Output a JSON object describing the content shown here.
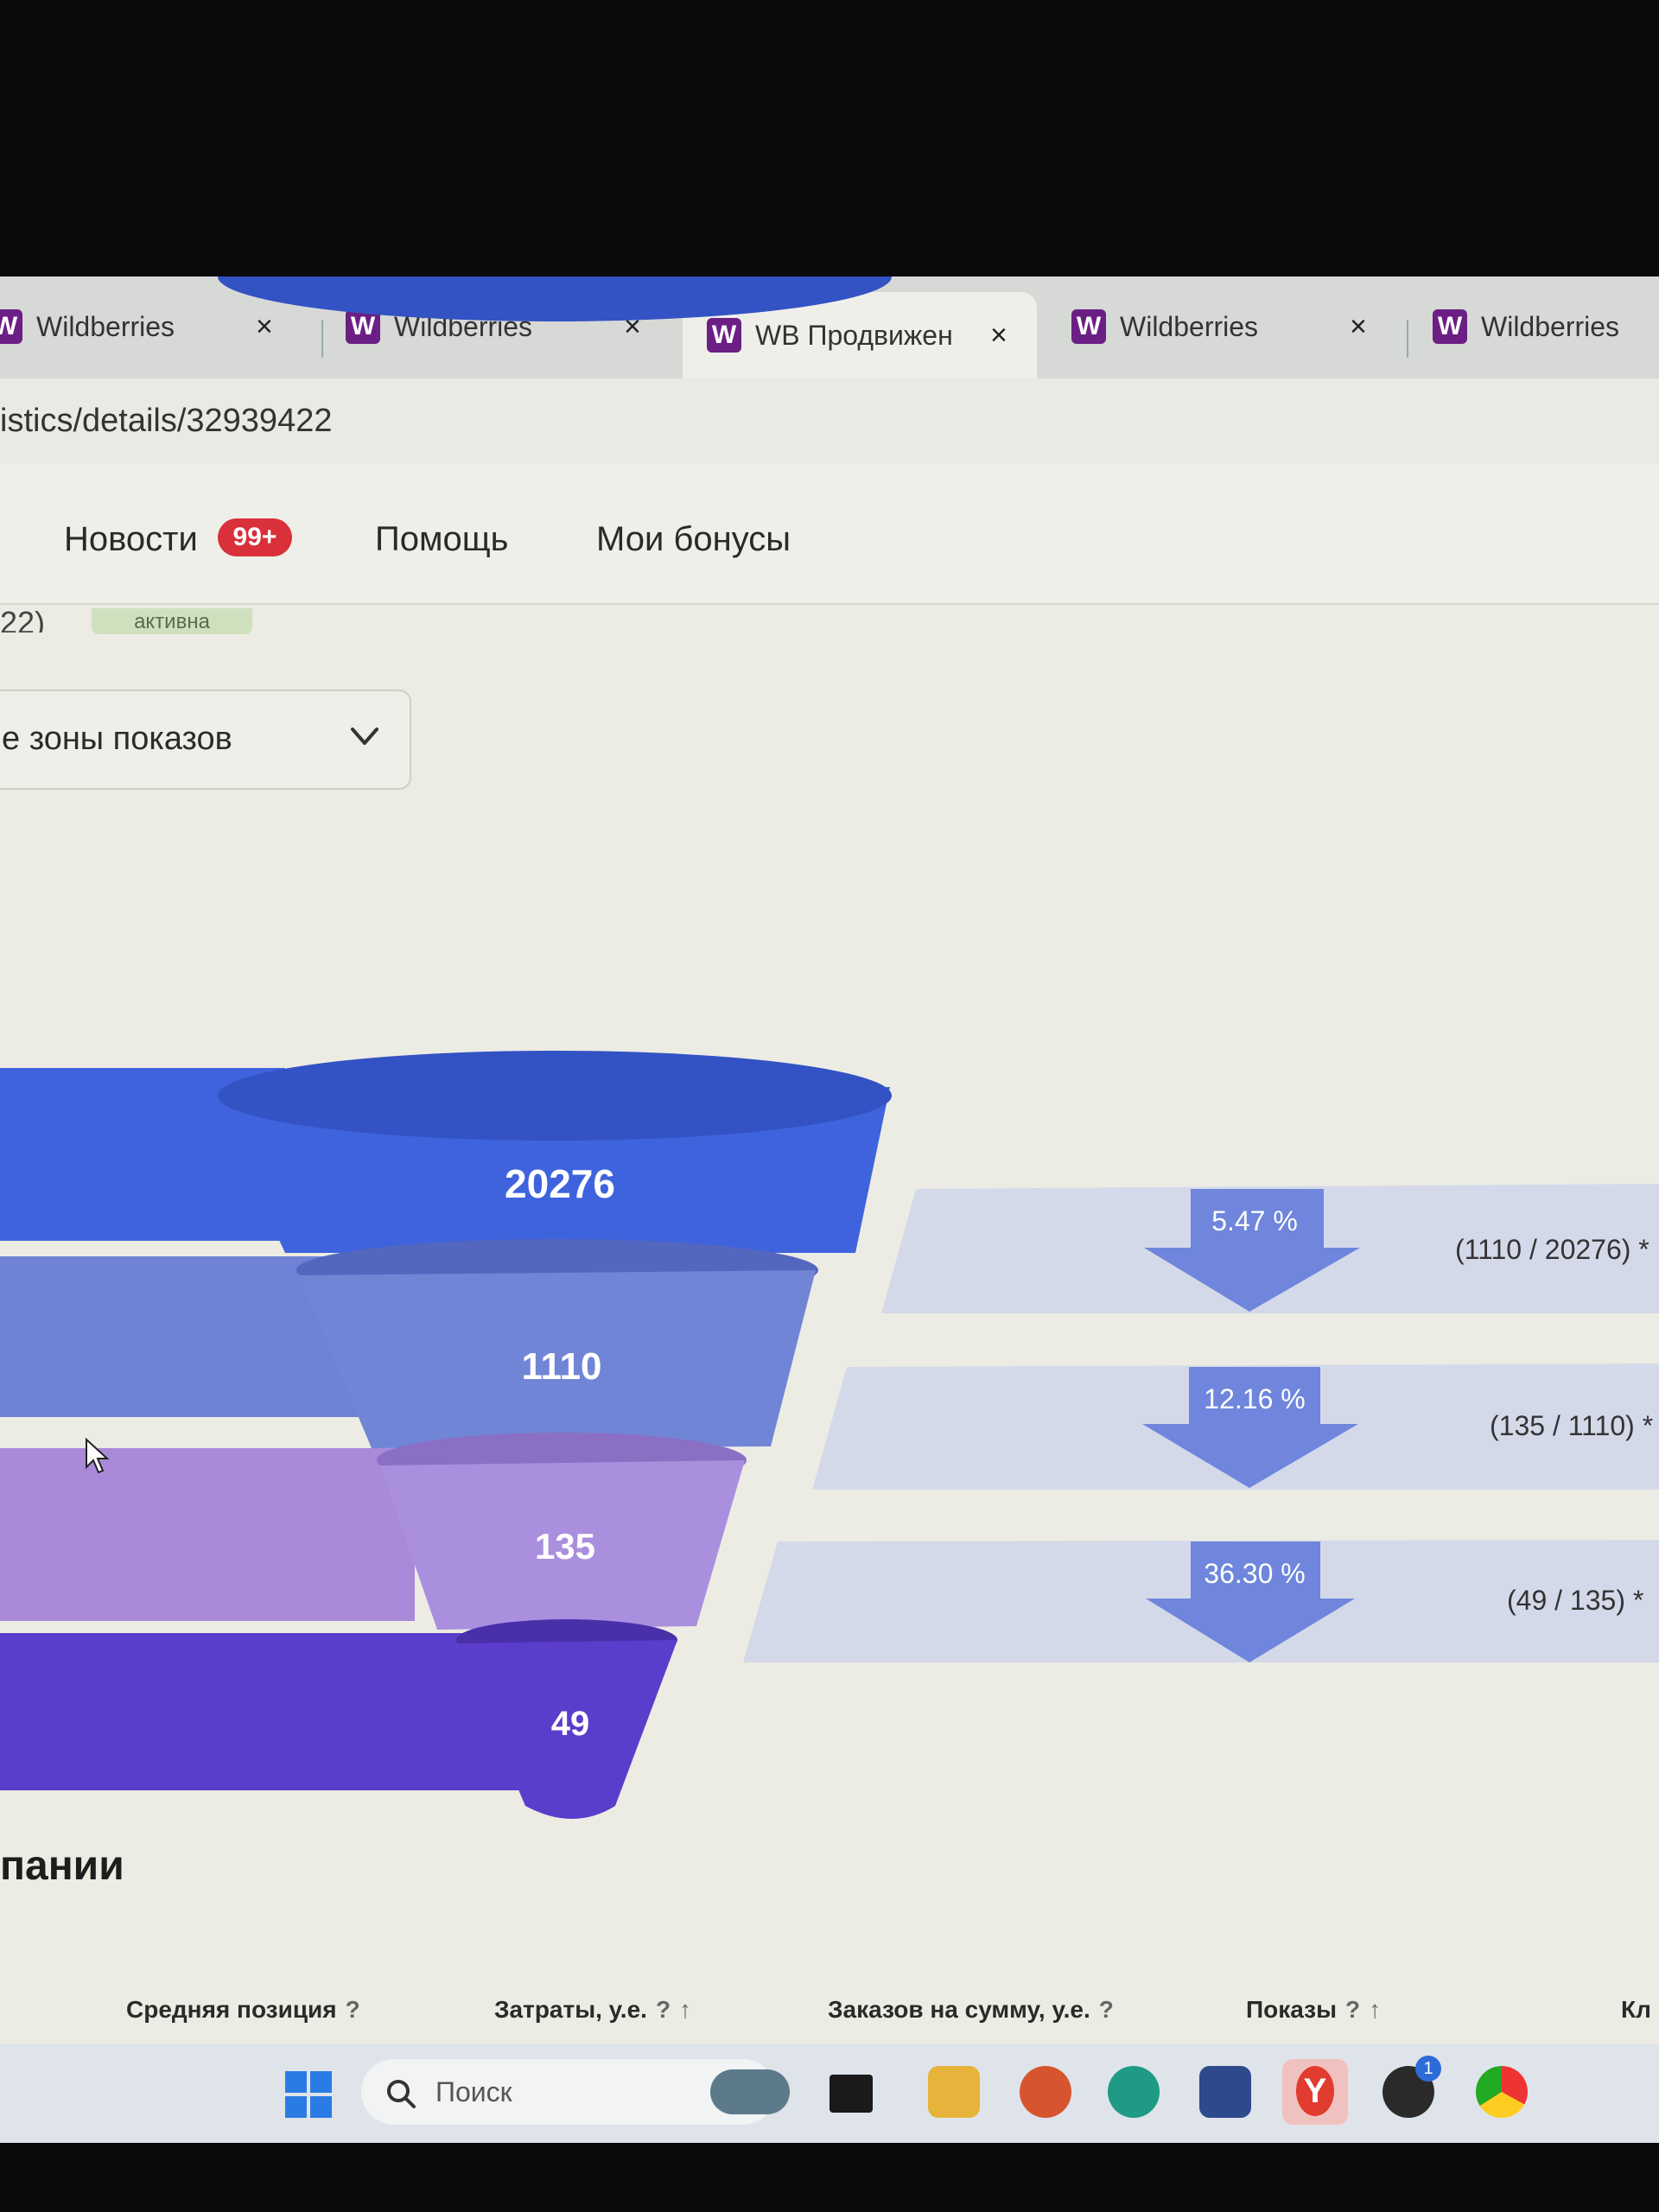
{
  "tabs": [
    {
      "label": "Wildberries",
      "active": false
    },
    {
      "label": "Wildberries",
      "active": false
    },
    {
      "label": "WB Продвижен",
      "active": true
    },
    {
      "label": "Wildberries",
      "active": false
    },
    {
      "label": "Wildberries",
      "active": false
    }
  ],
  "tab_logo": "W",
  "tab_close": "×",
  "address": {
    "url": "istics/details/32939422"
  },
  "nav": {
    "news_label": "Новости",
    "news_badge": "99+",
    "help_label": "Помощь",
    "bonus_label": "Мои бонусы"
  },
  "campaign": {
    "status_badge": "активна",
    "cut_paren": "22)"
  },
  "zone_select": {
    "value": "е зоны показов"
  },
  "funnel": {
    "stages": [
      {
        "value": "20276",
        "color": "#3e63dd"
      },
      {
        "value": "1110",
        "color": "#6f82d6"
      },
      {
        "value": "135",
        "color": "#a88ad8"
      },
      {
        "value": "49",
        "color": "#5b3dcc"
      }
    ],
    "conversions": [
      {
        "percent": "5.47 %",
        "ratio": "(1110 / 20276) *"
      },
      {
        "percent": "12.16 %",
        "ratio": "(135 / 1110) *"
      },
      {
        "percent": "36.30 %",
        "ratio": "(49 / 135) *"
      }
    ]
  },
  "section_title": "пании",
  "table_headers": [
    {
      "label": "Средняя позиция",
      "hint": "?"
    },
    {
      "label": "Затраты, у.е.",
      "hint": "?"
    },
    {
      "label": "Заказов на сумму, у.е.",
      "hint": "?"
    },
    {
      "label": "Показы",
      "hint": "?"
    },
    {
      "label": "Кл",
      "hint": ""
    }
  ],
  "taskbar": {
    "search_placeholder": "Поиск",
    "chat_badge": "1",
    "browser_letter": "Y"
  },
  "colors": {
    "accent": "#6b1f84",
    "badge": "#d9303a"
  }
}
